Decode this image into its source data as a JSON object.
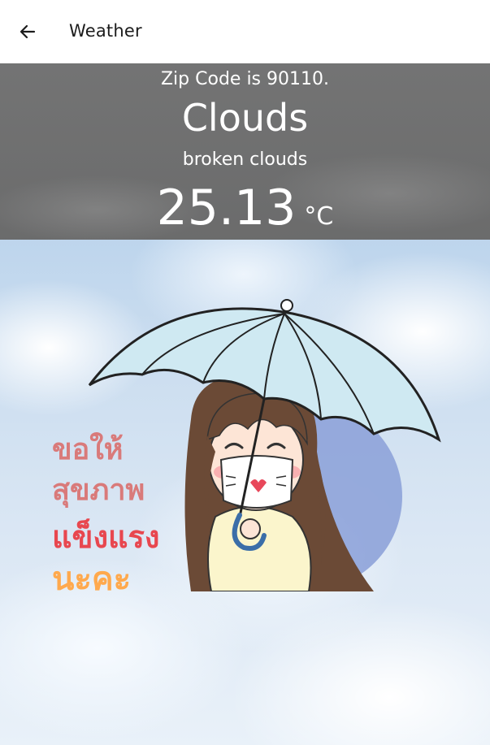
{
  "appbar": {
    "title": "Weather",
    "back_icon": "arrow-left-icon"
  },
  "weather": {
    "zip_text": "Zip Code is 90110.",
    "condition": "Clouds",
    "description": "broken clouds",
    "temperature": "25.13",
    "unit": "°C"
  },
  "sticker": {
    "lines": [
      "ขอให้",
      "สุขภาพ",
      "แข็งแรง",
      "นะคะ"
    ],
    "colors": [
      "#d97a7a",
      "#d97a7a",
      "#e8474f",
      "#ffa94d"
    ]
  }
}
